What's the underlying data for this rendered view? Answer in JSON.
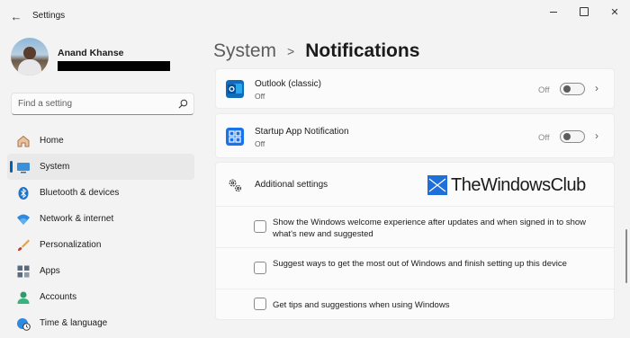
{
  "window": {
    "title": "Settings"
  },
  "profile": {
    "name": "Anand Khanse"
  },
  "search": {
    "placeholder": "Find a setting"
  },
  "sidebar": {
    "items": [
      {
        "label": "Home",
        "icon": "home-icon"
      },
      {
        "label": "System",
        "icon": "system-icon",
        "selected": true
      },
      {
        "label": "Bluetooth & devices",
        "icon": "bluetooth-icon"
      },
      {
        "label": "Network & internet",
        "icon": "wifi-icon"
      },
      {
        "label": "Personalization",
        "icon": "brush-icon"
      },
      {
        "label": "Apps",
        "icon": "apps-icon"
      },
      {
        "label": "Accounts",
        "icon": "account-icon"
      },
      {
        "label": "Time & language",
        "icon": "globe-clock-icon"
      }
    ]
  },
  "breadcrumb": {
    "root": "System",
    "separator": ">",
    "page": "Notifications"
  },
  "apps": [
    {
      "name": "Outlook (classic)",
      "status": "Off",
      "state_label": "Off",
      "toggle_on": false,
      "icon": "outlook-icon"
    },
    {
      "name": "Startup App Notification",
      "status": "Off",
      "state_label": "Off",
      "toggle_on": false,
      "icon": "startup-app-icon"
    }
  ],
  "additional": {
    "title": "Additional settings",
    "options": [
      {
        "text": "Show the Windows welcome experience after updates and when signed in to show what's new and suggested",
        "checked": false
      },
      {
        "text": "Suggest ways to get the most out of Windows and finish setting up this device",
        "checked": false
      },
      {
        "text": "Get tips and suggestions when using Windows",
        "checked": false
      }
    ]
  },
  "watermark": {
    "text": "TheWindowsClub"
  },
  "colors": {
    "accent": "#005fb8",
    "background": "#f3f3f3",
    "card": "#fbfbfb"
  }
}
